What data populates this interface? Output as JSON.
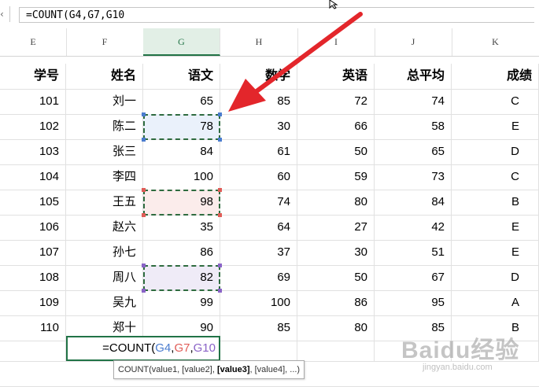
{
  "formula_bar": {
    "value": "=COUNT(G4,G7,G10"
  },
  "column_headers": [
    "E",
    "F",
    "G",
    "H",
    "I",
    "J",
    "K"
  ],
  "selected_column": "G",
  "table": {
    "headers": [
      "学号",
      "姓名",
      "语文",
      "数学",
      "英语",
      "总平均",
      "成绩"
    ],
    "rows": [
      [
        "101",
        "刘一",
        "65",
        "85",
        "72",
        "74",
        "C"
      ],
      [
        "102",
        "陈二",
        "78",
        "30",
        "66",
        "58",
        "E"
      ],
      [
        "103",
        "张三",
        "84",
        "61",
        "50",
        "65",
        "D"
      ],
      [
        "104",
        "李四",
        "100",
        "60",
        "59",
        "73",
        "C"
      ],
      [
        "105",
        "王五",
        "98",
        "74",
        "80",
        "84",
        "B"
      ],
      [
        "106",
        "赵六",
        "35",
        "64",
        "27",
        "42",
        "E"
      ],
      [
        "107",
        "孙七",
        "86",
        "37",
        "30",
        "51",
        "E"
      ],
      [
        "108",
        "周八",
        "82",
        "69",
        "50",
        "67",
        "D"
      ],
      [
        "109",
        "吴九",
        "99",
        "100",
        "86",
        "95",
        "A"
      ],
      [
        "110",
        "郑十",
        "90",
        "85",
        "80",
        "85",
        "B"
      ]
    ]
  },
  "formula_cell": {
    "prefix": "=COUNT(",
    "ref1": "G4",
    "sep1": ",",
    "ref2": "G7",
    "sep2": ",",
    "ref3": "G10"
  },
  "tooltip": {
    "pre": "COUNT(value1, [value2], ",
    "bold": "[value3]",
    "post": ", [value4], ...)"
  },
  "watermark": {
    "text": "Baidu经验",
    "sub": "jingyan.baidu.com"
  },
  "colors": {
    "ref_blue": "#4a7ccf",
    "ref_red": "#e05c57",
    "ref_purple": "#8a63c7",
    "arrow_red": "#e3262b",
    "excel_green": "#217346"
  }
}
